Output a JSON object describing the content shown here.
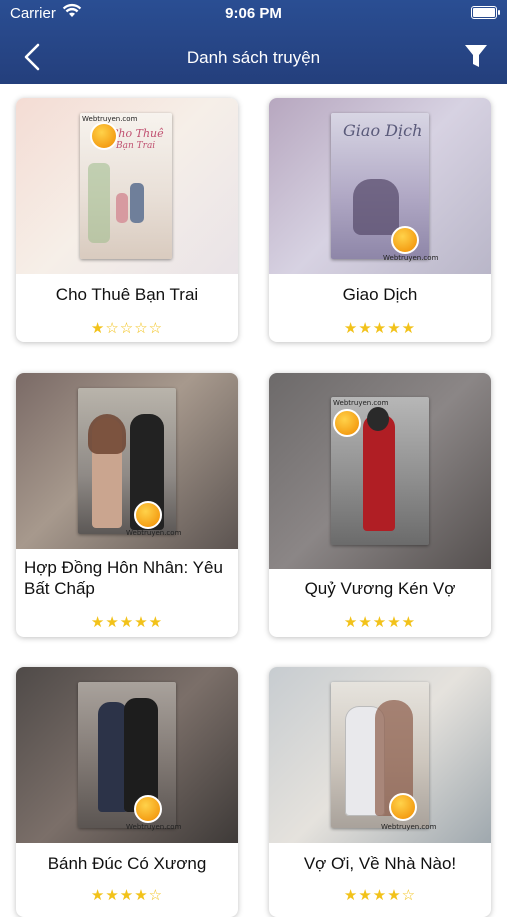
{
  "status": {
    "carrier": "Carrier",
    "time": "9:06 PM"
  },
  "header": {
    "title": "Danh sách truyện"
  },
  "icons": {
    "back": "chevron-left-icon",
    "filter": "filter-icon",
    "wifi": "wifi-icon",
    "battery": "battery-icon"
  },
  "colors": {
    "header": "#264584",
    "star": "#f2c21a"
  },
  "books": [
    {
      "title": "Cho Thuê Bạn Trai",
      "rating": 1.5,
      "cover_text": "Webtruyen.com",
      "cover_title": "Cho Thuê Bạn Trai"
    },
    {
      "title": "Giao Dịch",
      "rating": 5,
      "cover_text": "Webtruyen.com",
      "cover_title": "Giao Dịch"
    },
    {
      "title": "Hợp Đồng Hôn Nhân: Yêu Bất Chấp",
      "rating": 5,
      "cover_text": "Webtruyen.com"
    },
    {
      "title": "Quỷ Vương Kén Vợ",
      "rating": 5,
      "cover_text": "Webtruyen.com"
    },
    {
      "title": "Bánh Đúc Có Xương",
      "rating": 3.5,
      "cover_text": "Webtruyen.com"
    },
    {
      "title": "Vợ Ơi, Về Nhà Nào!",
      "rating": 3.5,
      "cover_text": "Webtruyen.com"
    }
  ]
}
